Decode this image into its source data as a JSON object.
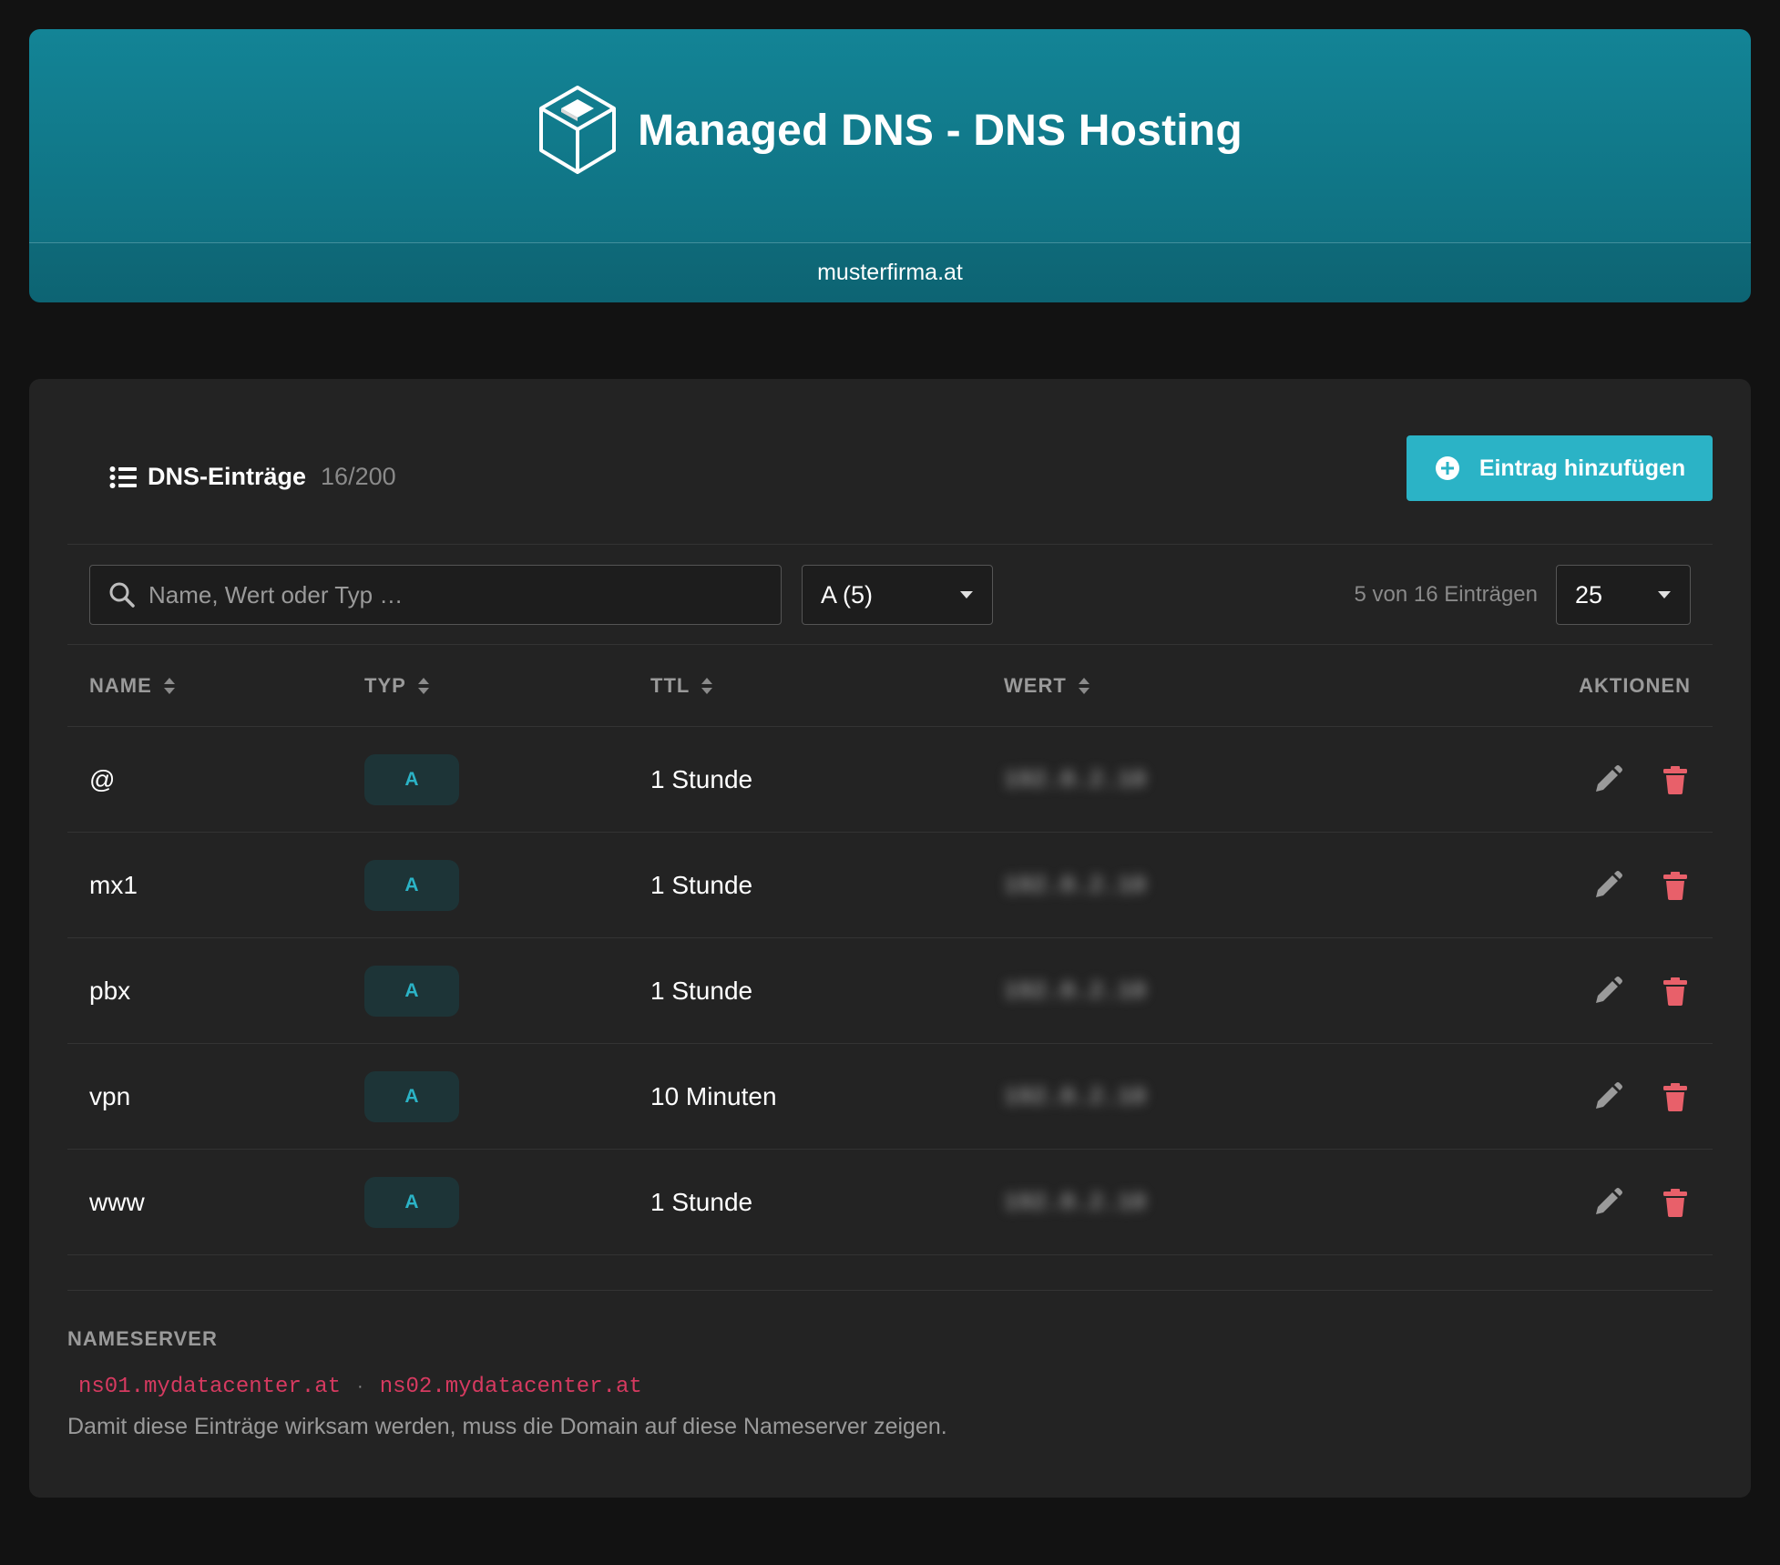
{
  "header": {
    "title": "Managed DNS - DNS Hosting",
    "domain": "musterfirma.at"
  },
  "section": {
    "title": "DNS-Einträge",
    "count": "16/200",
    "add_button_label": "Eintrag hinzufügen"
  },
  "filters": {
    "search_placeholder": "Name, Wert oder Typ …",
    "type_filter_value": "A (5)",
    "entries_info": "5 von 16 Einträgen",
    "page_size_value": "25"
  },
  "table": {
    "columns": {
      "name": "NAME",
      "type": "TYP",
      "ttl": "TTL",
      "value": "WERT",
      "actions": "AKTIONEN"
    },
    "rows": [
      {
        "name": "@",
        "type": "A",
        "ttl": "1 Stunde",
        "value": "192.0.2.10"
      },
      {
        "name": "mx1",
        "type": "A",
        "ttl": "1 Stunde",
        "value": "192.0.2.10"
      },
      {
        "name": "pbx",
        "type": "A",
        "ttl": "1 Stunde",
        "value": "192.0.2.10"
      },
      {
        "name": "vpn",
        "type": "A",
        "ttl": "10 Minuten",
        "value": "192.0.2.10"
      },
      {
        "name": "www",
        "type": "A",
        "ttl": "1 Stunde",
        "value": "192.0.2.10"
      }
    ]
  },
  "nameserver": {
    "heading": "NAMESERVER",
    "servers": [
      "ns01.mydatacenter.at",
      "ns02.mydatacenter.at"
    ],
    "separator": "·",
    "note": "Damit diese Einträge wirksam werden, muss die Domain auf diese Nameserver zeigen."
  },
  "colors": {
    "accent": "#2bb3c6",
    "banner": "#138496",
    "delete": "#e8606a",
    "nameserver": "#d63a60"
  },
  "icons": {
    "logo": "cube-icon",
    "section": "list-icon",
    "add": "plus-circle-icon",
    "search": "search-icon",
    "edit": "pencil-icon",
    "delete": "trash-icon"
  }
}
